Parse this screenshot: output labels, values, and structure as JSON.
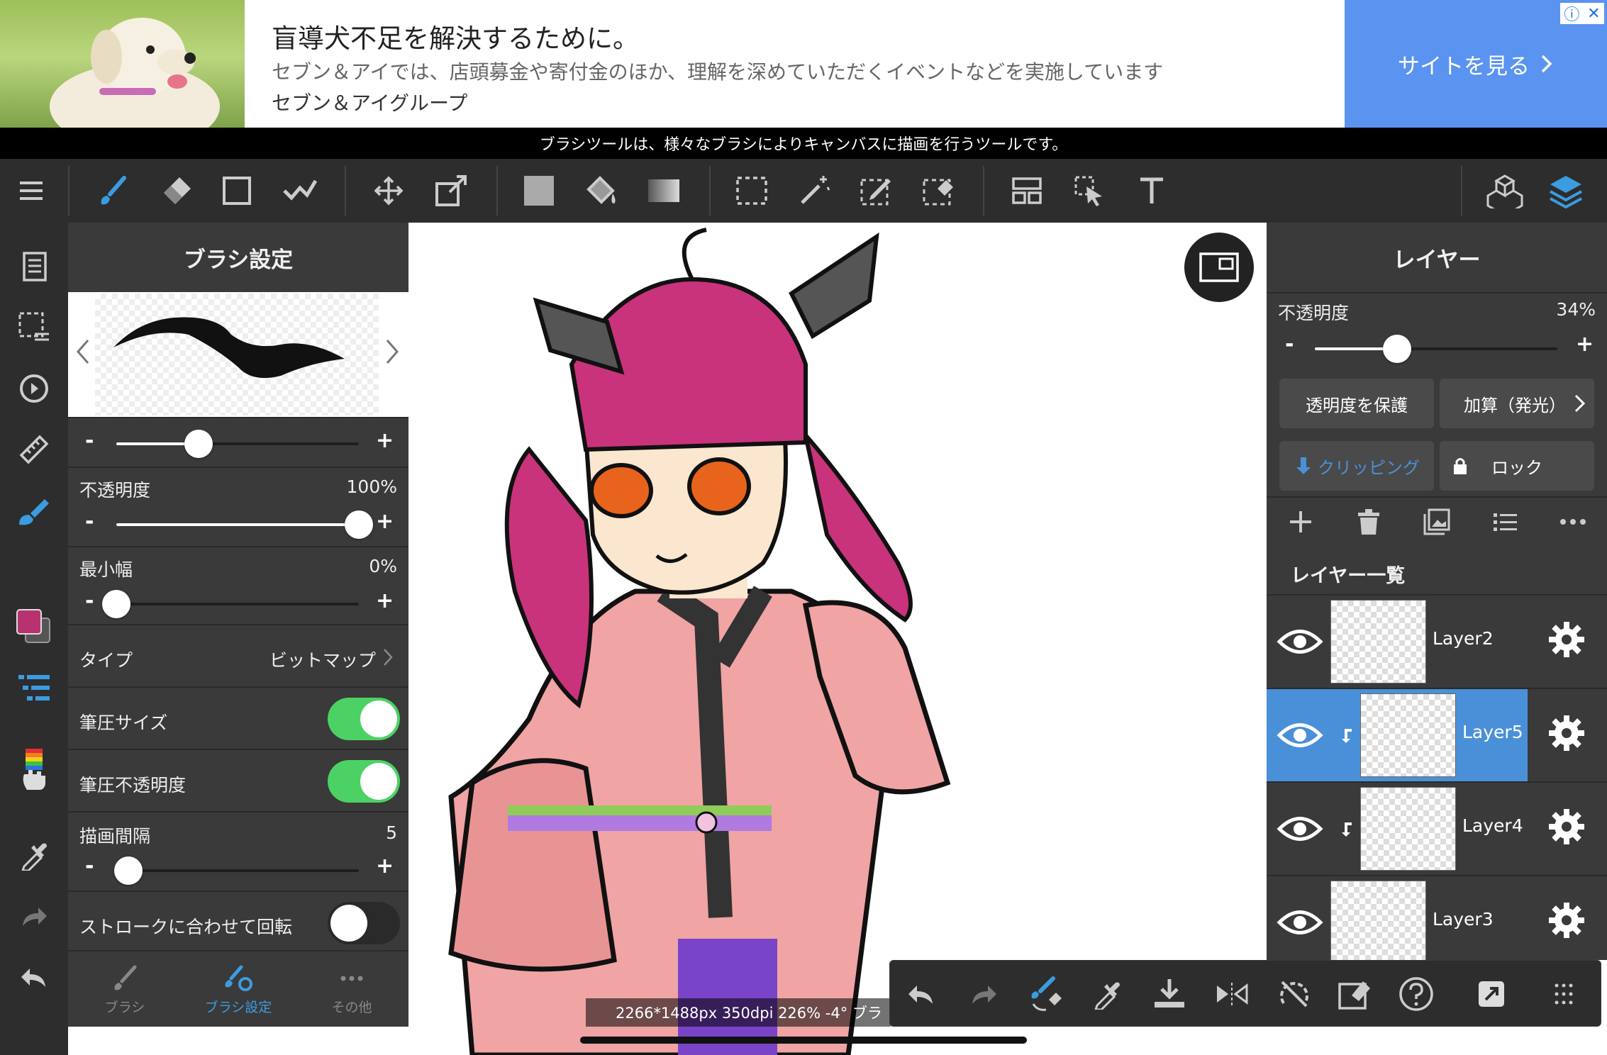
{
  "ad": {
    "title": "盲導犬不足を解決するために。",
    "description": "セブン＆アイでは、店頭募金や寄付金のほか、理解を深めていただくイベントなどを実施しています",
    "brand": "セブン＆アイグループ",
    "cta_label": "サイトを見る",
    "cta_color": "#5a94f0"
  },
  "hint": {
    "text": "ブラシツールは、様々なブラシによりキャンバスに描画を行うツールです。"
  },
  "toolbar": {
    "tools": [
      "menu-icon",
      "brush-icon",
      "eraser-icon",
      "rectangle-icon",
      "smudge-icon",
      "move-icon",
      "transform-icon",
      "fill-color-icon",
      "bucket-icon",
      "gradient-icon",
      "select-rect-icon",
      "magic-wand-icon",
      "select-pen-icon",
      "select-eraser-icon",
      "frame-divide-icon",
      "operation-icon",
      "text-icon",
      "materials-icon",
      "layers-icon"
    ],
    "active_color": "#3b9ce0"
  },
  "brush_panel": {
    "title": "ブラシ設定",
    "size_slider": {
      "value_fraction": 0.34
    },
    "opacity": {
      "label": "不透明度",
      "value": "100%",
      "fraction": 1.0
    },
    "min_width": {
      "label": "最小幅",
      "value": "0%",
      "fraction": 0.0
    },
    "type": {
      "label": "タイプ",
      "value": "ビットマップ"
    },
    "pressure_size": {
      "label": "筆圧サイズ",
      "on": true
    },
    "pressure_opacity": {
      "label": "筆圧不透明度",
      "on": true
    },
    "spacing": {
      "label": "描画間隔",
      "value": "5",
      "fraction": 0.05
    },
    "rotate": {
      "label": "ストロークに合わせて回転",
      "on": false
    },
    "minus": "-",
    "plus": "+",
    "toggle_on_color": "#4cd264",
    "tabs": [
      {
        "label": "ブラシ",
        "active": false
      },
      {
        "label": "ブラシ設定",
        "active": true
      },
      {
        "label": "その他",
        "active": false
      }
    ]
  },
  "canvas": {
    "status": "2266*1488px 350dpi 226% -4° ブラ",
    "current_color": "#b83270"
  },
  "layer_panel": {
    "title": "レイヤー",
    "opacity": {
      "label": "不透明度",
      "value": "34%",
      "fraction": 0.34
    },
    "protect_alpha": "透明度を保護",
    "blend_mode": "加算（発光）",
    "clipping": "クリッピング",
    "lock": "ロック",
    "list_title": "レイヤー一覧",
    "selected_color": "#4a90d9",
    "layers": [
      {
        "name": "Layer2",
        "clipped": false,
        "selected": false,
        "visible": true
      },
      {
        "name": "Layer5",
        "clipped": true,
        "selected": true,
        "visible": true
      },
      {
        "name": "Layer4",
        "clipped": true,
        "selected": false,
        "visible": true
      },
      {
        "name": "Layer3",
        "clipped": false,
        "selected": false,
        "visible": true
      }
    ]
  },
  "quick_bar": {
    "buttons": [
      "undo-icon",
      "redo-icon",
      "brush-eraser-switch-icon",
      "eyedropper-icon",
      "save-icon",
      "flip-icon",
      "rotate-reset-icon",
      "clear-icon",
      "help-icon",
      "fullscreen-icon",
      "grip-icon"
    ]
  }
}
